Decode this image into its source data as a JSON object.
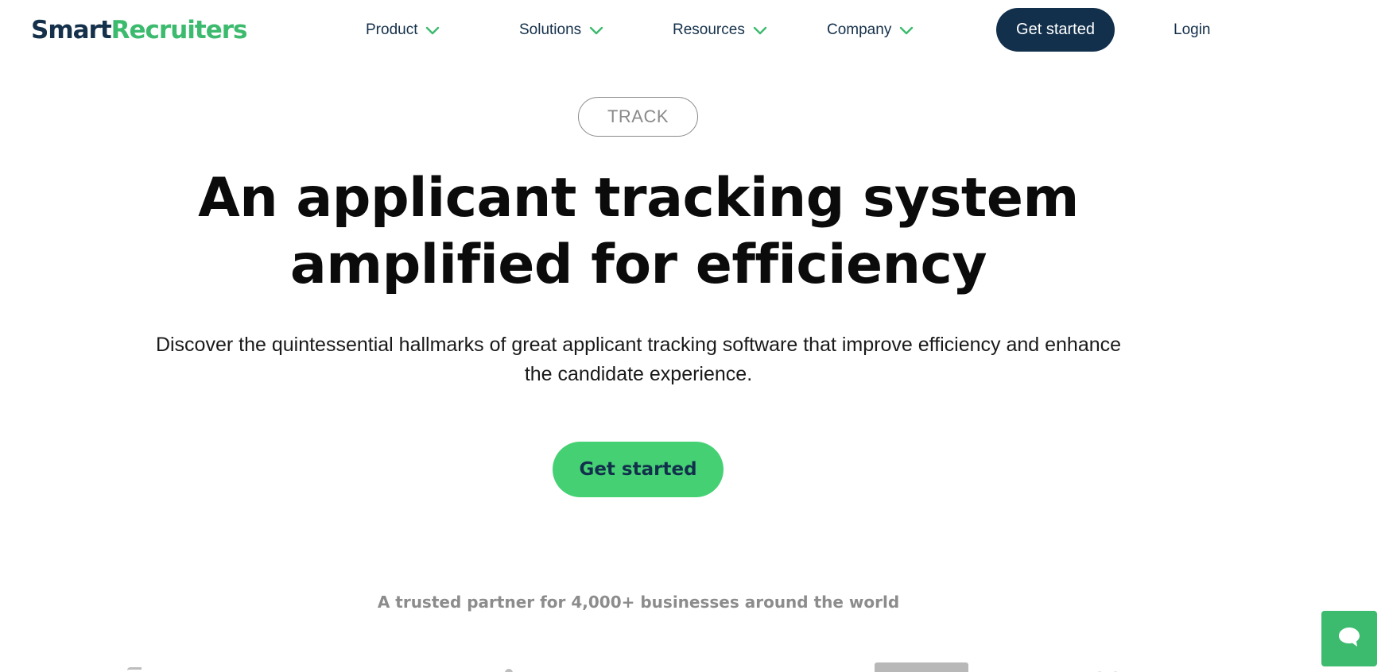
{
  "brand": {
    "logo_part1": "Smart",
    "logo_part2": "Recruiters",
    "primary_color": "#12304c",
    "accent_color": "#45d173"
  },
  "nav": {
    "items": [
      {
        "label": "Product"
      },
      {
        "label": "Solutions"
      },
      {
        "label": "Resources"
      },
      {
        "label": "Company"
      }
    ],
    "cta_label": "Get started",
    "login_label": "Login"
  },
  "hero": {
    "badge": "TRACK",
    "headline_line1": "An applicant tracking system",
    "headline_line2": "amplified for efficiency",
    "subtext_line1": "Discover the quintessential hallmarks of great applicant tracking software that improve efficiency and enhance",
    "subtext_line2": "the candidate experience.",
    "cta_label": "Get started"
  },
  "trusted": {
    "text": "A trusted partner for 4,000+ businesses around the world"
  },
  "icons": {
    "nav_dropdown": "chevron-down-icon",
    "chat": "chat-bubble-icon"
  }
}
